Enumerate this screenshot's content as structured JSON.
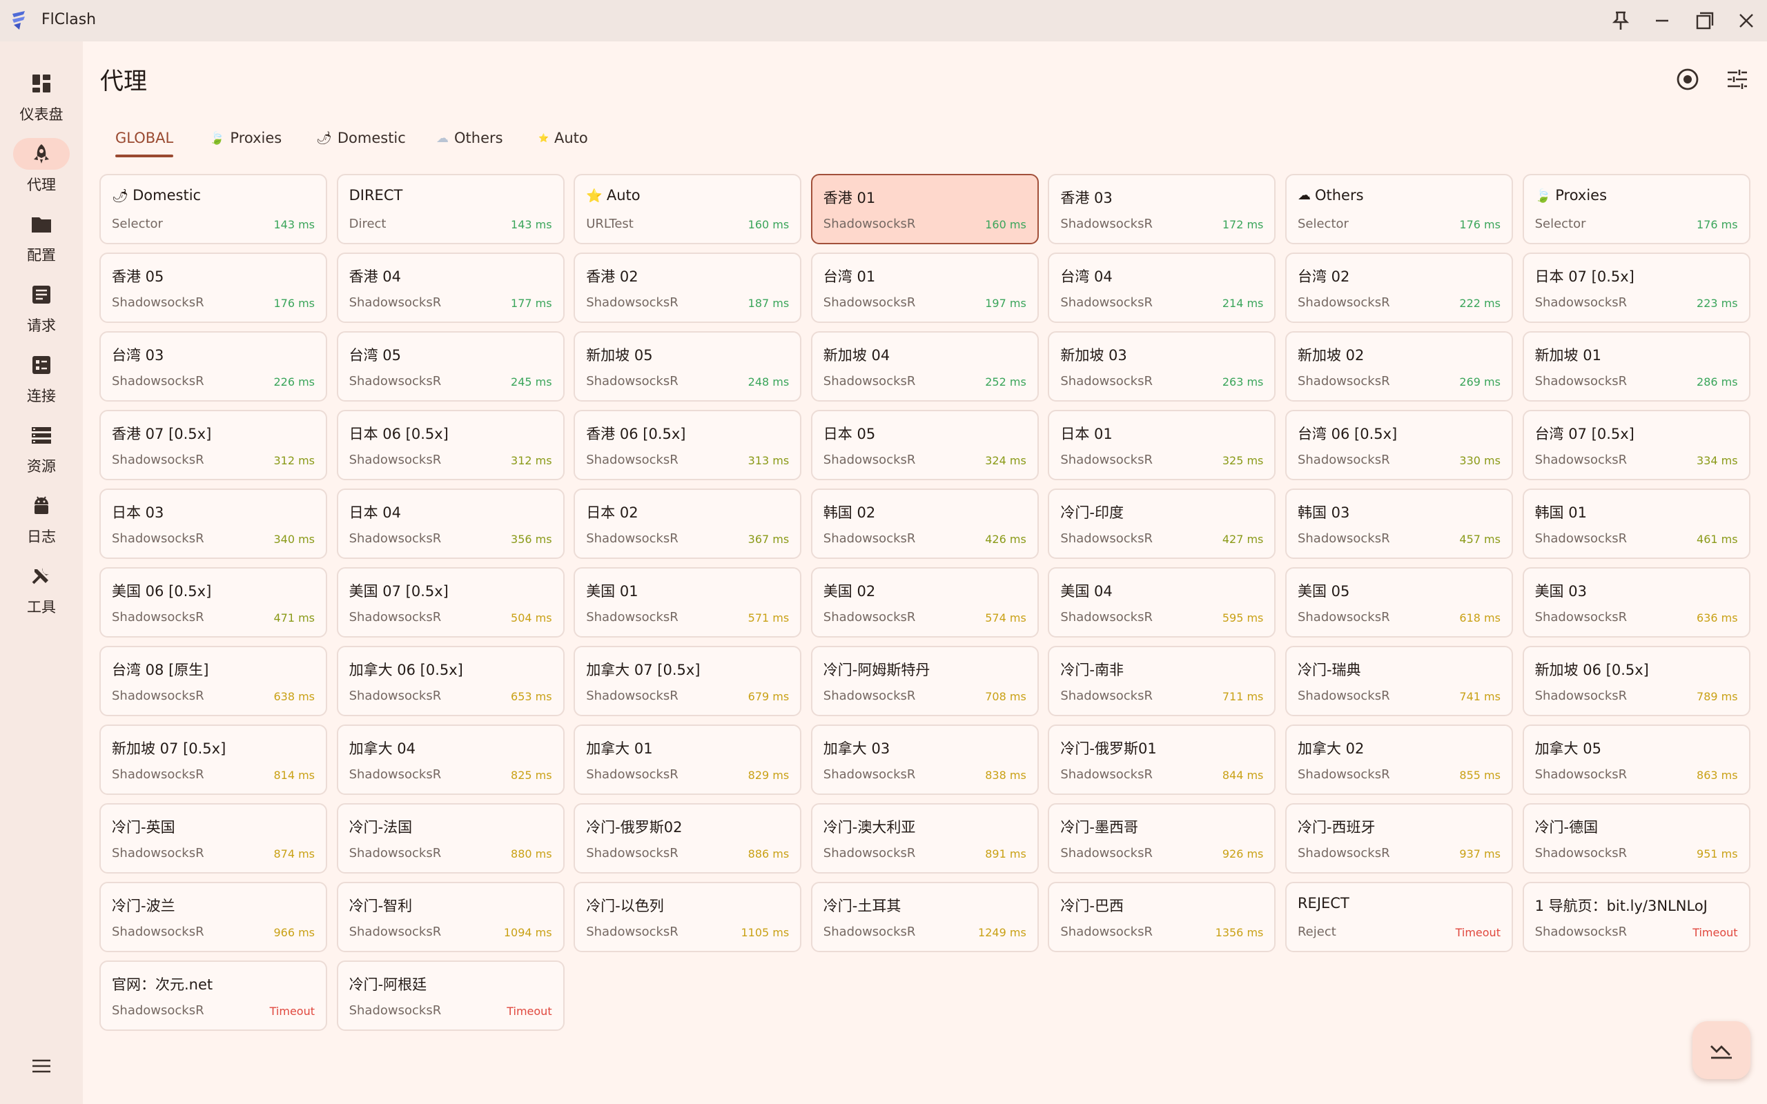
{
  "app": {
    "title": "FlClash"
  },
  "sidebar": {
    "items": [
      {
        "label": "仪表盘",
        "icon": "dashboard-icon",
        "active": false
      },
      {
        "label": "代理",
        "icon": "rocket-icon",
        "active": true
      },
      {
        "label": "配置",
        "icon": "folder-icon",
        "active": false
      },
      {
        "label": "请求",
        "icon": "request-icon",
        "active": false
      },
      {
        "label": "连接",
        "icon": "connection-icon",
        "active": false
      },
      {
        "label": "资源",
        "icon": "storage-icon",
        "active": false
      },
      {
        "label": "日志",
        "icon": "android-icon",
        "active": false
      },
      {
        "label": "工具",
        "icon": "tools-icon",
        "active": false
      }
    ]
  },
  "page": {
    "title": "代理"
  },
  "tabs": [
    {
      "label": "GLOBAL",
      "icon": "",
      "active": true
    },
    {
      "label": "Proxies",
      "icon": "🍃",
      "active": false
    },
    {
      "label": "Domestic",
      "icon": "🌶",
      "active": false
    },
    {
      "label": "Others",
      "icon": "☁",
      "active": false
    },
    {
      "label": "Auto",
      "icon": "⭐",
      "active": false
    }
  ],
  "colors": {
    "accent": "#9a4a31",
    "selected_bg": "#fed8cc",
    "background": "#fff4ef"
  },
  "proxies": [
    {
      "name": "Domestic",
      "icon": "🌶",
      "type": "Selector",
      "delay": "143 ms",
      "level": "green"
    },
    {
      "name": "DIRECT",
      "icon": "",
      "type": "Direct",
      "delay": "143 ms",
      "level": "green"
    },
    {
      "name": "Auto",
      "icon": "⭐",
      "type": "URLTest",
      "delay": "160 ms",
      "level": "green"
    },
    {
      "name": "香港 01",
      "icon": "",
      "type": "ShadowsocksR",
      "delay": "160 ms",
      "level": "green",
      "selected": true
    },
    {
      "name": "香港 03",
      "icon": "",
      "type": "ShadowsocksR",
      "delay": "172 ms",
      "level": "green"
    },
    {
      "name": "Others",
      "icon": "☁",
      "type": "Selector",
      "delay": "176 ms",
      "level": "green"
    },
    {
      "name": "Proxies",
      "icon": "🍃",
      "type": "Selector",
      "delay": "176 ms",
      "level": "green"
    },
    {
      "name": "香港 05",
      "icon": "",
      "type": "ShadowsocksR",
      "delay": "176 ms",
      "level": "green"
    },
    {
      "name": "香港 04",
      "icon": "",
      "type": "ShadowsocksR",
      "delay": "177 ms",
      "level": "green"
    },
    {
      "name": "香港 02",
      "icon": "",
      "type": "ShadowsocksR",
      "delay": "187 ms",
      "level": "green"
    },
    {
      "name": "台湾 01",
      "icon": "",
      "type": "ShadowsocksR",
      "delay": "197 ms",
      "level": "green"
    },
    {
      "name": "台湾 04",
      "icon": "",
      "type": "ShadowsocksR",
      "delay": "214 ms",
      "level": "green"
    },
    {
      "name": "台湾 02",
      "icon": "",
      "type": "ShadowsocksR",
      "delay": "222 ms",
      "level": "green"
    },
    {
      "name": "日本 07 [0.5x]",
      "icon": "",
      "type": "ShadowsocksR",
      "delay": "223 ms",
      "level": "green"
    },
    {
      "name": "台湾 03",
      "icon": "",
      "type": "ShadowsocksR",
      "delay": "226 ms",
      "level": "green"
    },
    {
      "name": "台湾 05",
      "icon": "",
      "type": "ShadowsocksR",
      "delay": "245 ms",
      "level": "green"
    },
    {
      "name": "新加坡 05",
      "icon": "",
      "type": "ShadowsocksR",
      "delay": "248 ms",
      "level": "green"
    },
    {
      "name": "新加坡 04",
      "icon": "",
      "type": "ShadowsocksR",
      "delay": "252 ms",
      "level": "green"
    },
    {
      "name": "新加坡 03",
      "icon": "",
      "type": "ShadowsocksR",
      "delay": "263 ms",
      "level": "green"
    },
    {
      "name": "新加坡 02",
      "icon": "",
      "type": "ShadowsocksR",
      "delay": "269 ms",
      "level": "green"
    },
    {
      "name": "新加坡 01",
      "icon": "",
      "type": "ShadowsocksR",
      "delay": "286 ms",
      "level": "green"
    },
    {
      "name": "香港 07 [0.5x]",
      "icon": "",
      "type": "ShadowsocksR",
      "delay": "312 ms",
      "level": "olive"
    },
    {
      "name": "日本 06 [0.5x]",
      "icon": "",
      "type": "ShadowsocksR",
      "delay": "312 ms",
      "level": "olive"
    },
    {
      "name": "香港 06 [0.5x]",
      "icon": "",
      "type": "ShadowsocksR",
      "delay": "313 ms",
      "level": "olive"
    },
    {
      "name": "日本 05",
      "icon": "",
      "type": "ShadowsocksR",
      "delay": "324 ms",
      "level": "olive"
    },
    {
      "name": "日本 01",
      "icon": "",
      "type": "ShadowsocksR",
      "delay": "325 ms",
      "level": "olive"
    },
    {
      "name": "台湾 06 [0.5x]",
      "icon": "",
      "type": "ShadowsocksR",
      "delay": "330 ms",
      "level": "olive"
    },
    {
      "name": "台湾 07 [0.5x]",
      "icon": "",
      "type": "ShadowsocksR",
      "delay": "334 ms",
      "level": "olive"
    },
    {
      "name": "日本 03",
      "icon": "",
      "type": "ShadowsocksR",
      "delay": "340 ms",
      "level": "olive"
    },
    {
      "name": "日本 04",
      "icon": "",
      "type": "ShadowsocksR",
      "delay": "356 ms",
      "level": "olive"
    },
    {
      "name": "日本 02",
      "icon": "",
      "type": "ShadowsocksR",
      "delay": "367 ms",
      "level": "olive"
    },
    {
      "name": "韩国 02",
      "icon": "",
      "type": "ShadowsocksR",
      "delay": "426 ms",
      "level": "olive"
    },
    {
      "name": "冷门-印度",
      "icon": "",
      "type": "ShadowsocksR",
      "delay": "427 ms",
      "level": "olive"
    },
    {
      "name": "韩国 03",
      "icon": "",
      "type": "ShadowsocksR",
      "delay": "457 ms",
      "level": "olive"
    },
    {
      "name": "韩国 01",
      "icon": "",
      "type": "ShadowsocksR",
      "delay": "461 ms",
      "level": "olive"
    },
    {
      "name": "美国 06 [0.5x]",
      "icon": "",
      "type": "ShadowsocksR",
      "delay": "471 ms",
      "level": "olive"
    },
    {
      "name": "美国 07 [0.5x]",
      "icon": "",
      "type": "ShadowsocksR",
      "delay": "504 ms",
      "level": "amber"
    },
    {
      "name": "美国 01",
      "icon": "",
      "type": "ShadowsocksR",
      "delay": "571 ms",
      "level": "amber"
    },
    {
      "name": "美国 02",
      "icon": "",
      "type": "ShadowsocksR",
      "delay": "574 ms",
      "level": "amber"
    },
    {
      "name": "美国 04",
      "icon": "",
      "type": "ShadowsocksR",
      "delay": "595 ms",
      "level": "amber"
    },
    {
      "name": "美国 05",
      "icon": "",
      "type": "ShadowsocksR",
      "delay": "618 ms",
      "level": "amber"
    },
    {
      "name": "美国 03",
      "icon": "",
      "type": "ShadowsocksR",
      "delay": "636 ms",
      "level": "amber"
    },
    {
      "name": "台湾 08 [原生]",
      "icon": "",
      "type": "ShadowsocksR",
      "delay": "638 ms",
      "level": "amber"
    },
    {
      "name": "加拿大 06 [0.5x]",
      "icon": "",
      "type": "ShadowsocksR",
      "delay": "653 ms",
      "level": "amber"
    },
    {
      "name": "加拿大 07 [0.5x]",
      "icon": "",
      "type": "ShadowsocksR",
      "delay": "679 ms",
      "level": "amber"
    },
    {
      "name": "冷门-阿姆斯特丹",
      "icon": "",
      "type": "ShadowsocksR",
      "delay": "708 ms",
      "level": "amber"
    },
    {
      "name": "冷门-南非",
      "icon": "",
      "type": "ShadowsocksR",
      "delay": "711 ms",
      "level": "amber"
    },
    {
      "name": "冷门-瑞典",
      "icon": "",
      "type": "ShadowsocksR",
      "delay": "741 ms",
      "level": "amber"
    },
    {
      "name": "新加坡 06 [0.5x]",
      "icon": "",
      "type": "ShadowsocksR",
      "delay": "789 ms",
      "level": "amber"
    },
    {
      "name": "新加坡 07 [0.5x]",
      "icon": "",
      "type": "ShadowsocksR",
      "delay": "814 ms",
      "level": "amber"
    },
    {
      "name": "加拿大 04",
      "icon": "",
      "type": "ShadowsocksR",
      "delay": "825 ms",
      "level": "amber"
    },
    {
      "name": "加拿大 01",
      "icon": "",
      "type": "ShadowsocksR",
      "delay": "829 ms",
      "level": "amber"
    },
    {
      "name": "加拿大 03",
      "icon": "",
      "type": "ShadowsocksR",
      "delay": "838 ms",
      "level": "amber"
    },
    {
      "name": "冷门-俄罗斯01",
      "icon": "",
      "type": "ShadowsocksR",
      "delay": "844 ms",
      "level": "amber"
    },
    {
      "name": "加拿大 02",
      "icon": "",
      "type": "ShadowsocksR",
      "delay": "855 ms",
      "level": "amber"
    },
    {
      "name": "加拿大 05",
      "icon": "",
      "type": "ShadowsocksR",
      "delay": "863 ms",
      "level": "amber"
    },
    {
      "name": "冷门-英国",
      "icon": "",
      "type": "ShadowsocksR",
      "delay": "874 ms",
      "level": "amber"
    },
    {
      "name": "冷门-法国",
      "icon": "",
      "type": "ShadowsocksR",
      "delay": "880 ms",
      "level": "amber"
    },
    {
      "name": "冷门-俄罗斯02",
      "icon": "",
      "type": "ShadowsocksR",
      "delay": "886 ms",
      "level": "amber"
    },
    {
      "name": "冷门-澳大利亚",
      "icon": "",
      "type": "ShadowsocksR",
      "delay": "891 ms",
      "level": "amber"
    },
    {
      "name": "冷门-墨西哥",
      "icon": "",
      "type": "ShadowsocksR",
      "delay": "926 ms",
      "level": "amber"
    },
    {
      "name": "冷门-西班牙",
      "icon": "",
      "type": "ShadowsocksR",
      "delay": "937 ms",
      "level": "amber"
    },
    {
      "name": "冷门-德国",
      "icon": "",
      "type": "ShadowsocksR",
      "delay": "951 ms",
      "level": "amber"
    },
    {
      "name": "冷门-波兰",
      "icon": "",
      "type": "ShadowsocksR",
      "delay": "966 ms",
      "level": "amber"
    },
    {
      "name": "冷门-智利",
      "icon": "",
      "type": "ShadowsocksR",
      "delay": "1094 ms",
      "level": "amber"
    },
    {
      "name": "冷门-以色列",
      "icon": "",
      "type": "ShadowsocksR",
      "delay": "1105 ms",
      "level": "amber"
    },
    {
      "name": "冷门-土耳其",
      "icon": "",
      "type": "ShadowsocksR",
      "delay": "1249 ms",
      "level": "amber"
    },
    {
      "name": "冷门-巴西",
      "icon": "",
      "type": "ShadowsocksR",
      "delay": "1356 ms",
      "level": "amber"
    },
    {
      "name": "REJECT",
      "icon": "",
      "type": "Reject",
      "delay": "Timeout",
      "level": "red"
    },
    {
      "name": "1 导航页：bit.ly/3NLNLoJ",
      "icon": "",
      "type": "ShadowsocksR",
      "delay": "Timeout",
      "level": "red"
    },
    {
      "name": "官网：次元.net",
      "icon": "",
      "type": "ShadowsocksR",
      "delay": "Timeout",
      "level": "red"
    },
    {
      "name": "冷门-阿根廷",
      "icon": "",
      "type": "ShadowsocksR",
      "delay": "Timeout",
      "level": "red"
    }
  ]
}
